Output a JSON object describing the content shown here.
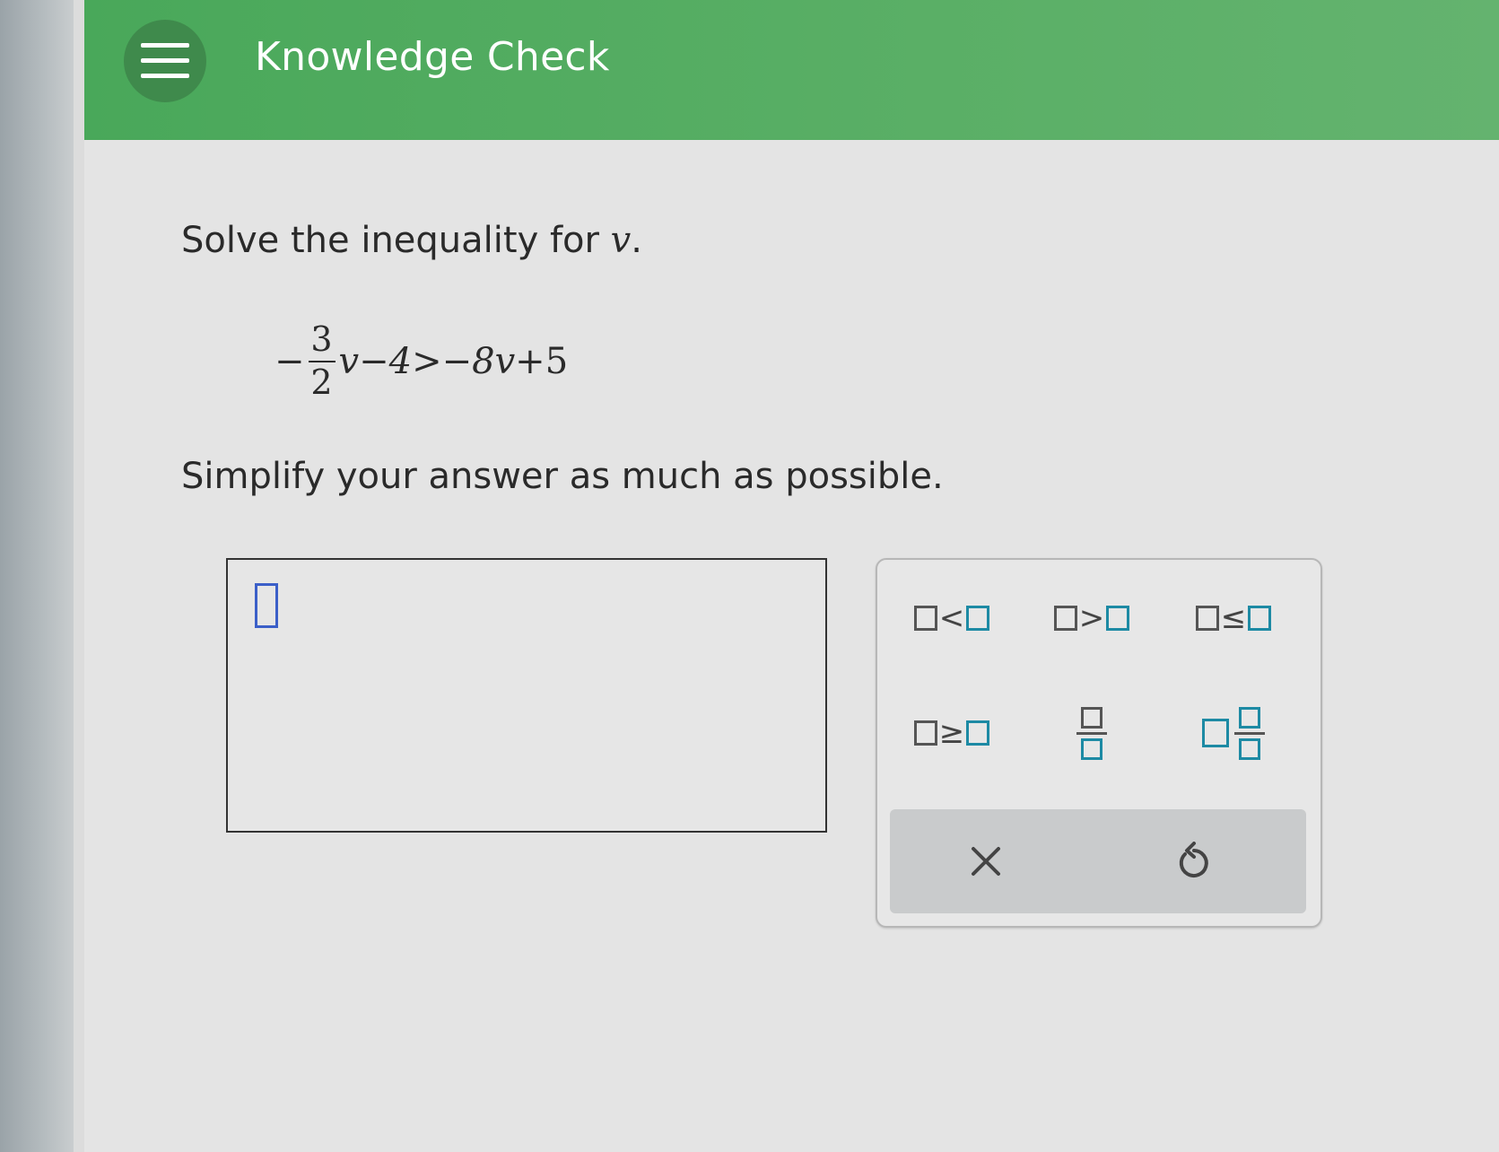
{
  "header": {
    "title": "Knowledge Check",
    "menu_icon": "hamburger-menu-icon"
  },
  "question": {
    "prompt_prefix": "Solve the inequality for ",
    "variable": "v",
    "prompt_suffix": ".",
    "equation": {
      "leading_sign": "−",
      "numerator": "3",
      "denominator": "2",
      "after_fraction": "v−4>−8",
      "variable2": "v",
      "tail": "+5"
    },
    "instruction": "Simplify your answer as much as possible."
  },
  "answer": {
    "value": ""
  },
  "keypad": {
    "keys": [
      {
        "name": "less-than",
        "symbol": "<"
      },
      {
        "name": "greater-than",
        "symbol": ">"
      },
      {
        "name": "less-equal",
        "symbol": "≤"
      },
      {
        "name": "greater-equal",
        "symbol": "≥"
      },
      {
        "name": "fraction",
        "symbol": ""
      },
      {
        "name": "mixed-number",
        "symbol": ""
      }
    ],
    "clear_icon": "close-icon",
    "undo_icon": "undo-icon"
  },
  "colors": {
    "header_green": "#4faa5e",
    "template_blue": "#1d8aa4",
    "cursor_blue": "#3b5fc8"
  }
}
